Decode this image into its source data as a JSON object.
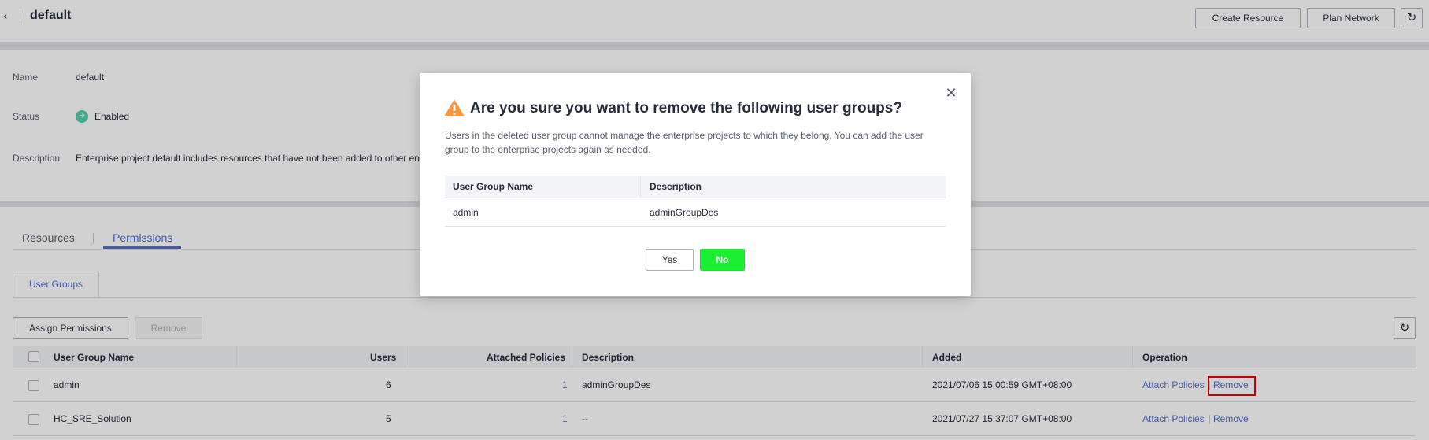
{
  "header": {
    "title": "default",
    "back_icon": "chevron-left-icon",
    "create_resource_label": "Create Resource",
    "plan_network_label": "Plan Network",
    "refresh_icon": "refresh-icon"
  },
  "info": {
    "name_label": "Name",
    "name_value": "default",
    "status_label": "Status",
    "status_value": "Enabled",
    "description_label": "Description",
    "description_value": "Enterprise project default includes resources that have not been added to other en"
  },
  "tabs": [
    {
      "label": "Resources",
      "active": false
    },
    {
      "label": "Permissions",
      "active": true
    }
  ],
  "subtab": {
    "label": "User Groups"
  },
  "toolbar": {
    "assign_label": "Assign Permissions",
    "remove_label": "Remove"
  },
  "table": {
    "columns": [
      "User Group Name",
      "Users",
      "Attached Policies",
      "Description",
      "Added",
      "Operation"
    ],
    "rows": [
      {
        "name": "admin",
        "users": "6",
        "policies": "1",
        "description": "adminGroupDes",
        "added": "2021/07/06 15:00:59 GMT+08:00",
        "op_attach": "Attach Policies",
        "op_remove": "Remove"
      },
      {
        "name": "HC_SRE_Solution",
        "users": "5",
        "policies": "1",
        "description": "--",
        "added": "2021/07/27 15:37:07 GMT+08:00",
        "op_attach": "Attach Policies",
        "op_remove": "Remove"
      }
    ]
  },
  "dialog": {
    "title": "Are you sure you want to remove the following user groups?",
    "message": "Users in the deleted user group cannot manage the enterprise projects to which they belong. You can add the user group to the enterprise projects again as needed.",
    "columns": [
      "User Group Name",
      "Description"
    ],
    "row": {
      "name": "admin",
      "description": "adminGroupDes"
    },
    "yes_label": "Yes",
    "no_label": "No",
    "warning_icon": "warning-icon",
    "close_icon": "close-icon"
  },
  "colors": {
    "accent": "#526ecc",
    "confirm_green": "#1bef31",
    "warning": "#fa9841",
    "status_enabled": "#50d4ab",
    "highlight": "#ee0000"
  }
}
